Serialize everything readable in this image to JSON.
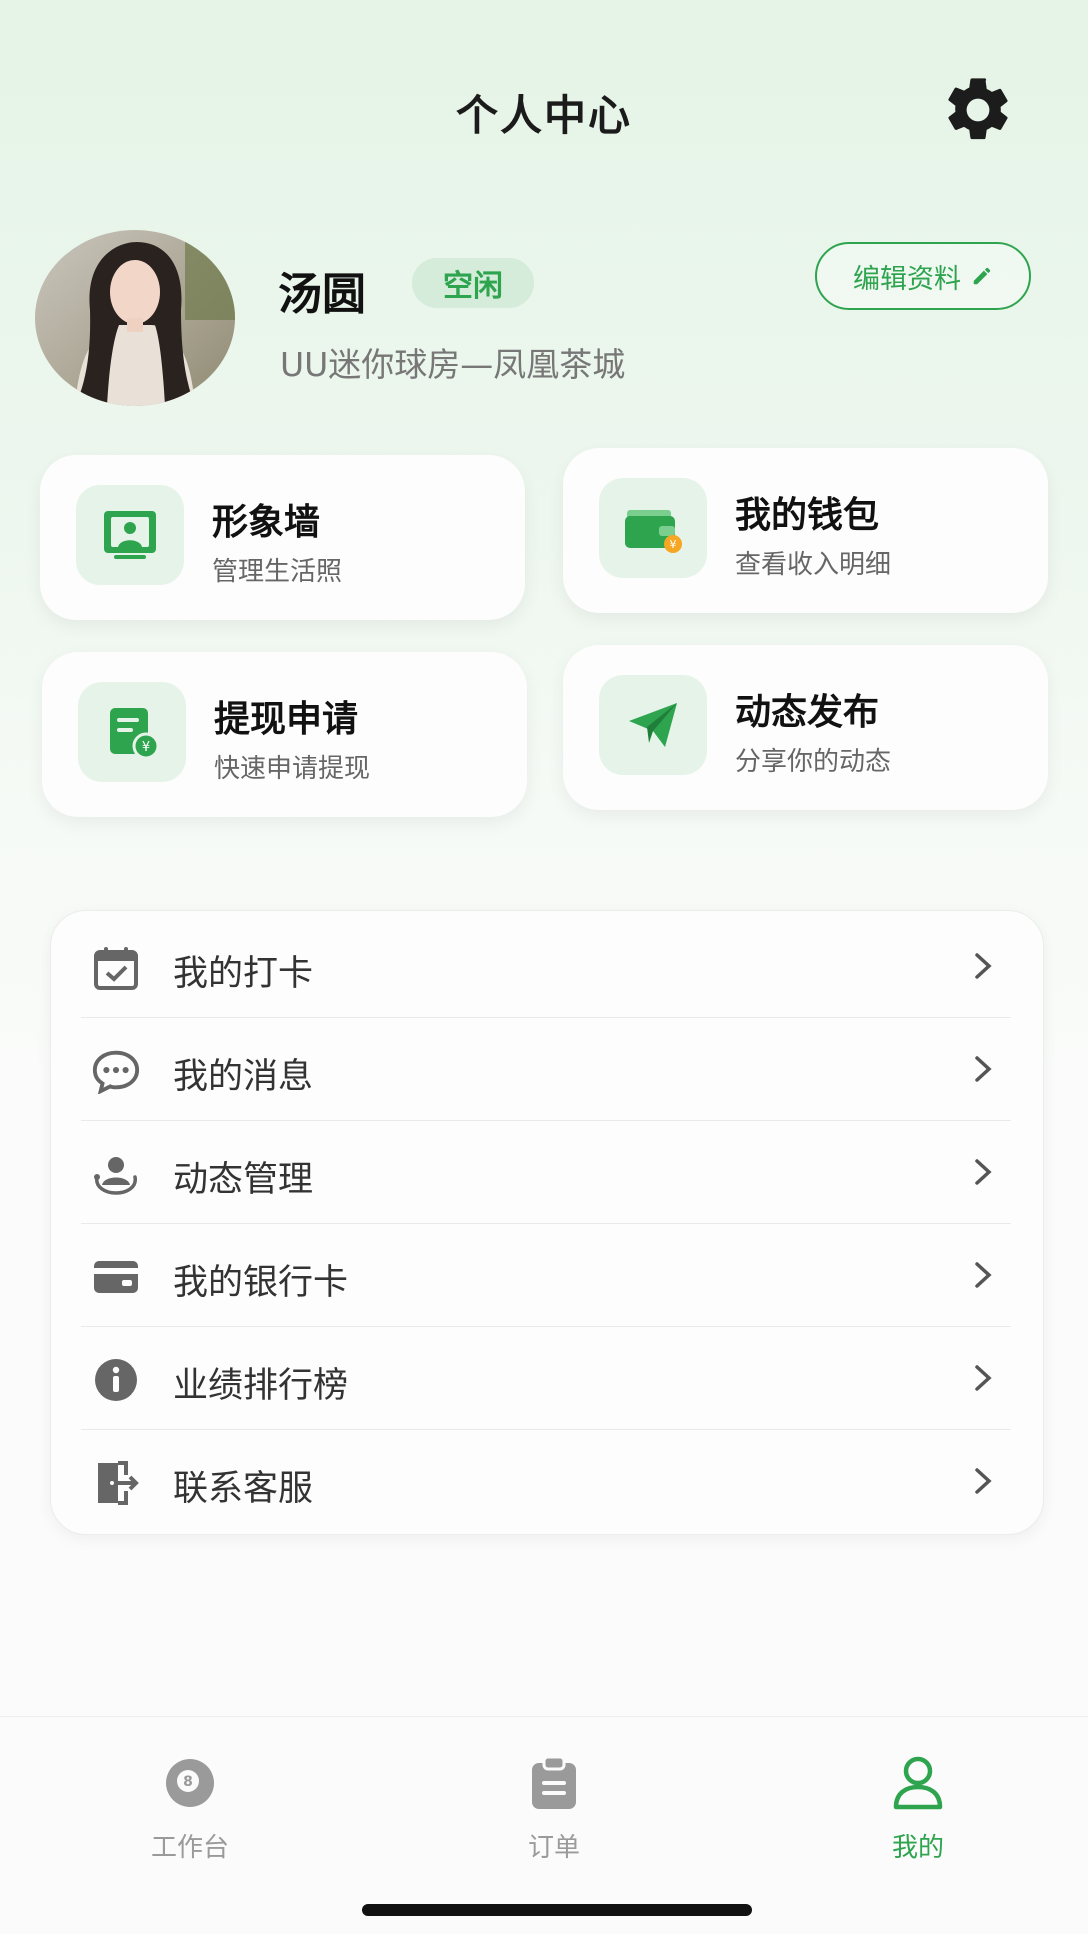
{
  "header": {
    "title": "个人中心",
    "settings_icon": "gear-icon"
  },
  "profile": {
    "name": "汤圆",
    "status": "空闲",
    "store": "UU迷你球房—凤凰茶城",
    "edit_label": "编辑资料",
    "edit_icon": "pencil-icon"
  },
  "cards": [
    {
      "title": "形象墙",
      "subtitle": "管理生活照",
      "icon": "photo-icon"
    },
    {
      "title": "我的钱包",
      "subtitle": "查看收入明细",
      "icon": "wallet-icon"
    },
    {
      "title": "提现申请",
      "subtitle": "快速申请提现",
      "icon": "withdraw-icon"
    },
    {
      "title": "动态发布",
      "subtitle": "分享你的动态",
      "icon": "paper-plane-icon"
    }
  ],
  "menu": [
    {
      "label": "我的打卡",
      "icon": "calendar-check-icon"
    },
    {
      "label": "我的消息",
      "icon": "chat-bubble-icon"
    },
    {
      "label": "动态管理",
      "icon": "user-share-icon"
    },
    {
      "label": "我的银行卡",
      "icon": "bank-card-icon"
    },
    {
      "label": "业绩排行榜",
      "icon": "info-icon"
    },
    {
      "label": "联系客服",
      "icon": "exit-door-icon"
    }
  ],
  "nav": [
    {
      "label": "工作台",
      "icon": "billiard-ball-icon",
      "active": false
    },
    {
      "label": "订单",
      "icon": "clipboard-icon",
      "active": false
    },
    {
      "label": "我的",
      "icon": "user-icon",
      "active": true
    }
  ],
  "colors": {
    "accent": "#2ea44f",
    "badge_bg": "#d4ecd9",
    "icon_gray": "#666666"
  }
}
